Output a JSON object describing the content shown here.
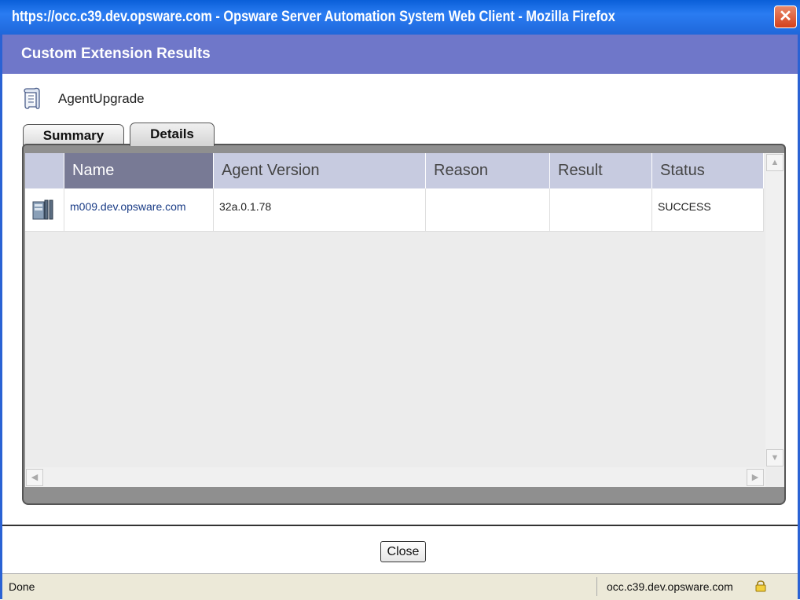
{
  "window": {
    "title": "https://occ.c39.dev.opsware.com - Opsware Server Automation System Web Client - Mozilla Firefox",
    "close_glyph": "✕"
  },
  "header": {
    "title": "Custom Extension Results"
  },
  "extension": {
    "name": "AgentUpgrade",
    "icon": "script-scroll-icon"
  },
  "tabs": [
    {
      "label": "Summary",
      "selected": false
    },
    {
      "label": "Details",
      "selected": true
    }
  ],
  "table": {
    "columns": [
      "Name",
      "Agent Version",
      "Reason",
      "Result",
      "Status"
    ],
    "sorted_column": "Name",
    "rows": [
      {
        "icon": "server-icon",
        "name": "m009.dev.opsware.com",
        "agent_version": "32a.0.1.78",
        "reason": "",
        "result": "",
        "status": "SUCCESS"
      }
    ]
  },
  "footer": {
    "close_label": "Close"
  },
  "statusbar": {
    "left": "Done",
    "host": "occ.c39.dev.opsware.com",
    "icon": "lock-icon"
  },
  "colors": {
    "title_bar": "#1f67da",
    "header_bar": "#6f77c9",
    "column_header": "#c7cbe0",
    "sorted_header": "#787a95",
    "link": "#1a3c86"
  }
}
